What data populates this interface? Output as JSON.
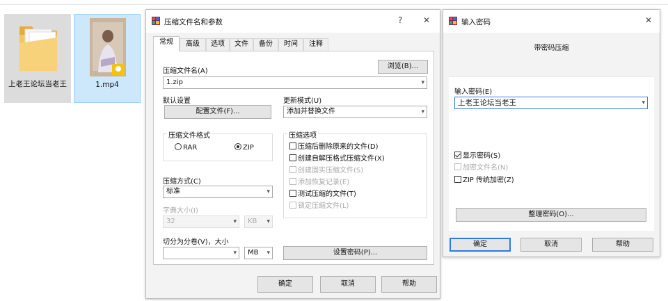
{
  "desktop": {
    "files": [
      {
        "name": "上老王论坛当老王",
        "icon": "folder-icon"
      },
      {
        "name": "1.mp4",
        "icon": "video-file-icon"
      }
    ]
  },
  "archive_dialog": {
    "title": "压缩文件名和参数",
    "help_glyph": "?",
    "close_glyph": "✕",
    "tabs": [
      "常规",
      "高级",
      "选项",
      "文件",
      "备份",
      "时间",
      "注释"
    ],
    "archive_name_label": "压缩文件名(A)",
    "browse_label": "浏览(B)...",
    "archive_name_value": "1.zip",
    "default_settings_label": "默认设置",
    "profiles_label": "配置文件(F)...",
    "update_mode_label": "更新模式(U)",
    "update_mode_value": "添加并替换文件",
    "format_group_label": "压缩文件格式",
    "format_rar": "RAR",
    "format_zip": "ZIP",
    "method_label": "压缩方式(C)",
    "method_value": "标准",
    "dict_label": "字典大小(I)",
    "dict_value": "32",
    "dict_unit": "KB",
    "split_label": "切分为分卷(V)，大小",
    "split_value": "",
    "split_unit": "MB",
    "options_group_label": "压缩选项",
    "options": [
      {
        "label": "压缩后删除原来的文件(D)",
        "checked": false,
        "enabled": true
      },
      {
        "label": "创建自解压格式压缩文件(X)",
        "checked": false,
        "enabled": true
      },
      {
        "label": "创建固实压缩文件(S)",
        "checked": false,
        "enabled": false
      },
      {
        "label": "添加恢复记录(E)",
        "checked": false,
        "enabled": false
      },
      {
        "label": "测试压缩的文件(T)",
        "checked": false,
        "enabled": true
      },
      {
        "label": "锁定压缩文件(L)",
        "checked": false,
        "enabled": false
      }
    ],
    "set_password_label": "设置密码(P)...",
    "ok_label": "确定",
    "cancel_label": "取消",
    "help_label": "帮助"
  },
  "password_dialog": {
    "title": "输入密码",
    "close_glyph": "✕",
    "subtitle": "带密码压缩",
    "password_label": "输入密码(E)",
    "password_value": "上老王论坛当老王",
    "show_password_label": "显示密码(S)",
    "show_password_checked": true,
    "encrypt_names_label": "加密文件名(N)",
    "zip_legacy_label": "ZIP 传统加密(Z)",
    "organize_label": "整理密码(O)...",
    "ok_label": "确定",
    "cancel_label": "取消",
    "help_label": "帮助"
  },
  "colors": {
    "winrar_icon": "#b5322e",
    "selection": "#cde7fb",
    "focus": "#2c7be5"
  }
}
